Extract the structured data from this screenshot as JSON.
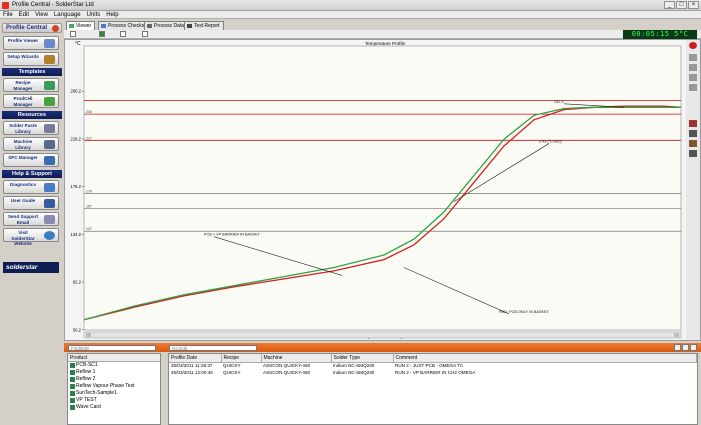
{
  "window": {
    "title": "Profile Central - SolderStar Ltd",
    "buttons": [
      "_",
      "□",
      "×"
    ]
  },
  "menu": [
    "File",
    "Edit",
    "View",
    "Language",
    "Units",
    "Help"
  ],
  "sidebar": {
    "header": "Profile Central",
    "top_buttons": [
      {
        "label": "Profile Viewer",
        "icon": "magnifier-icon"
      },
      {
        "label": "Setup Wizards",
        "icon": "wand-icon"
      }
    ],
    "sections": [
      {
        "title": "Templates",
        "items": [
          {
            "label": "Recipe Manager",
            "icon": "recipe-icon"
          },
          {
            "label": "ProdCell Manager",
            "icon": "prodcell-icon"
          }
        ]
      },
      {
        "title": "Resources",
        "items": [
          {
            "label": "Solder Paste Library",
            "icon": "paste-icon"
          },
          {
            "label": "Machine Library",
            "icon": "machine-icon"
          },
          {
            "label": "SPC Manager",
            "icon": "spc-icon"
          }
        ]
      },
      {
        "title": "Help & Support",
        "items": [
          {
            "label": "Diagnostics",
            "icon": "diagnostics-icon"
          },
          {
            "label": "User Guide",
            "icon": "book-icon"
          },
          {
            "label": "Send Support Email",
            "icon": "email-icon"
          },
          {
            "label": "Visit SolderStar Website",
            "icon": "globe-icon"
          }
        ]
      }
    ],
    "brand": "solderstar"
  },
  "tabs": [
    {
      "label": "Viewer",
      "active": true
    },
    {
      "label": "Process Checks",
      "active": false
    },
    {
      "label": "Process Data",
      "active": false
    },
    {
      "label": "Test Report",
      "active": false
    }
  ],
  "clock": "00:05:15 5°C",
  "chart_data": {
    "type": "line",
    "title": "Temperature Profile",
    "ylabel": "°C",
    "xlabel": "[Time M:SS ------]",
    "ylim": [
      50,
      300
    ],
    "ytick_labels": [
      "50.2",
      "92.2",
      "134.2",
      "176.2",
      "218.2",
      "260.2"
    ],
    "yticks": [
      50.2,
      92.2,
      134.2,
      176.2,
      218.2,
      260.2
    ],
    "ref_lines": [
      {
        "value": 157,
        "label": "157"
      },
      {
        "value": 137,
        "label": "137",
        "color": "#333333"
      },
      {
        "value": 170,
        "label": "170",
        "color": "#333333"
      },
      {
        "value": 240,
        "label": "240",
        "color": "#c01010"
      },
      {
        "value": 252,
        "label": "",
        "color": "#c01010"
      },
      {
        "value": 217,
        "label": "217",
        "color": "#c01010"
      }
    ],
    "series": [
      {
        "name": "",
        "color": "#d42020",
        "points": [
          [
            0,
            59
          ],
          [
            50,
            70
          ],
          [
            100,
            80
          ],
          [
            150,
            88
          ],
          [
            200,
            95
          ],
          [
            250,
            102
          ],
          [
            300,
            112
          ],
          [
            330,
            125
          ],
          [
            360,
            148
          ],
          [
            390,
            180
          ],
          [
            420,
            212
          ],
          [
            450,
            235
          ],
          [
            480,
            244
          ],
          [
            510,
            246
          ],
          [
            540,
            247
          ],
          [
            560,
            247
          ],
          [
            580,
            247
          ],
          [
            597,
            246
          ]
        ]
      },
      {
        "name": "",
        "color": "#30a040",
        "points": [
          [
            0,
            59
          ],
          [
            50,
            71
          ],
          [
            100,
            81
          ],
          [
            150,
            89
          ],
          [
            200,
            97
          ],
          [
            250,
            105
          ],
          [
            300,
            116
          ],
          [
            330,
            130
          ],
          [
            360,
            154
          ],
          [
            390,
            186
          ],
          [
            420,
            218
          ],
          [
            450,
            239
          ],
          [
            480,
            245
          ],
          [
            510,
            246
          ],
          [
            540,
            246
          ],
          [
            560,
            246
          ],
          [
            580,
            246
          ],
          [
            597,
            246
          ]
        ]
      }
    ],
    "annotations": [
      {
        "text": "232.3",
        "tx": 470,
        "ty": 250,
        "ax": 540,
        "ay": 246
      },
      {
        "text": "2.43 [°C/Sec]",
        "tx": 455,
        "ty": 215,
        "ax": 370,
        "ay": 163
      },
      {
        "text": "PCB + VP BARRIER IN BASKET",
        "tx": 120,
        "ty": 133,
        "ax": 258,
        "ay": 98
      },
      {
        "text": "RED: PCB ONLY IN BASKET",
        "tx": 415,
        "ty": 65,
        "ax": 320,
        "ay": 105
      }
    ],
    "grid": false
  },
  "bottom": {
    "field1_placeholder": "Find/Edit",
    "field2_placeholder": "Go Edit",
    "product_header": "Product",
    "products": [
      "PCB-SC1",
      "Reflow 1",
      "Reflow 2",
      "Reflow Vapour Phase Test",
      "SunTech-Sample1",
      "VP TEST",
      "Wave Card"
    ],
    "columns": [
      "Profile Date",
      "Recipe",
      "Machine",
      "Solder Type",
      "Comment"
    ],
    "rows": [
      [
        "25/03/2011 11:29:37",
        "QUICKY",
        "ASSCON QUICKY-450",
        "Indium NC-SMQ230",
        "RUN 2 - JUST PCB - OMEGA TC"
      ],
      [
        "25/03/2011 12:00:46",
        "QUICKY",
        "ASSCON QUICKY-450",
        "Indium NC-SMQ230",
        "RUN 2 - VP BARRIER IN CH2 OMEGA"
      ]
    ]
  },
  "colors": {
    "accent": "#1a2f7a",
    "orange": "#e86a20",
    "profile_red": "#d42020",
    "profile_green": "#30a040"
  }
}
